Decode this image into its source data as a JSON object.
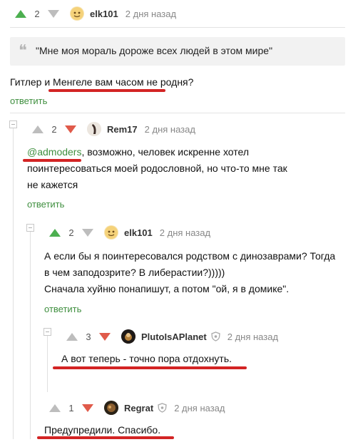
{
  "comments": [
    {
      "score": "2",
      "username": "elk101",
      "time": "2 дня назад"
    },
    {
      "score": "2",
      "username": "Rem17",
      "time": "2 дня назад",
      "mention": "@admoders",
      "text_lines": [
        ", возможно, человек искренне хотел",
        "поинтересоваться моей родословной, но что-то мне так",
        "не кажется"
      ],
      "reply": "ответить"
    },
    {
      "score": "2",
      "username": "elk101",
      "time": "2 дня назад",
      "text_lines": [
        "А если бы я поинтересовался родством с динозаврами? Тогда",
        "в чем заподозрите? В либерастии?)))))",
        "Сначала хуйню понапишут, а потом \"ой, я в домике\"."
      ],
      "reply": "ответить"
    },
    {
      "score": "3",
      "username": "PlutoIsAPlanet",
      "time": "2 дня назад",
      "text_lines": [
        "А вот теперь - точно пора отдохнуть."
      ]
    },
    {
      "score": "1",
      "username": "Regrat",
      "time": "2 дня назад",
      "text_lines": [
        "Предупредили. Спасибо."
      ]
    }
  ],
  "quote": {
    "text": "\"Мне моя мораль дороже всех людей в этом мире\""
  },
  "top_text": "Гитлер и Менгеле вам часом не родня?",
  "top_reply": "ответить",
  "colors": {
    "up": "#4caf50",
    "down": "#e05a4a",
    "underline": "#d32424",
    "link": "#3f8f3f"
  },
  "icons": [
    "upvote-arrow-icon",
    "downvote-arrow-icon",
    "quote-icon",
    "collapse-icon",
    "shield-icon"
  ]
}
